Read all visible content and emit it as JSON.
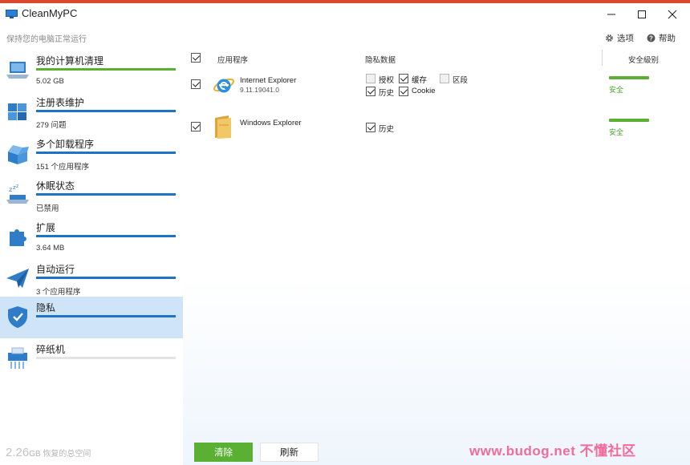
{
  "window": {
    "title": "CleanMyPC",
    "subtitle": "保持您的电脑正常运行"
  },
  "top_options": {
    "options_label": "选项",
    "help_label": "帮助"
  },
  "sidebar": {
    "items": [
      {
        "label": "我的计算机清理",
        "sub": "5.02 GB",
        "icon": "laptop-icon"
      },
      {
        "label": "注册表维护",
        "sub": "279 问题",
        "icon": "registry-cubes-icon"
      },
      {
        "label": "多个卸载程序",
        "sub": "151 个应用程序",
        "icon": "open-box-icon"
      },
      {
        "label": "休眠状态",
        "sub": "已禁用",
        "icon": "sleep-laptop-icon"
      },
      {
        "label": "扩展",
        "sub": "3.64 MB",
        "icon": "puzzle-icon"
      },
      {
        "label": "自动运行",
        "sub": "3 个应用程序",
        "icon": "paper-plane-icon"
      },
      {
        "label": "隐私",
        "sub": "",
        "icon": "shield-icon"
      },
      {
        "label": "碎纸机",
        "sub": "",
        "icon": "shredder-icon"
      }
    ],
    "total_value": "2.26",
    "total_unit": "GB",
    "total_label": "恢复的总空间"
  },
  "table": {
    "col_app": "应用程序",
    "col_privacy": "隐私数据",
    "col_safety": "安全級别",
    "rows": [
      {
        "name": "Internet Explorer",
        "version": "9.11.19041.0",
        "icon": "internet-explorer-icon",
        "options": [
          {
            "label": "授权",
            "checked": false
          },
          {
            "label": "缓存",
            "checked": true
          },
          {
            "label": "区段",
            "checked": false
          },
          {
            "label": "历史",
            "checked": true
          },
          {
            "label": "Cookie",
            "checked": true
          }
        ],
        "safety": "安全"
      },
      {
        "name": "Windows Explorer",
        "version": "",
        "icon": "folder-icon",
        "options": [
          {
            "label": "历史",
            "checked": true
          }
        ],
        "safety": "安全"
      }
    ]
  },
  "buttons": {
    "clean": "清除",
    "refresh": "刷新"
  },
  "watermark": "www.budog.net 不懂社区",
  "colors": {
    "accent_green": "#5ab033",
    "accent_blue": "#1f73c6",
    "active_bg": "#cfe4f7"
  }
}
